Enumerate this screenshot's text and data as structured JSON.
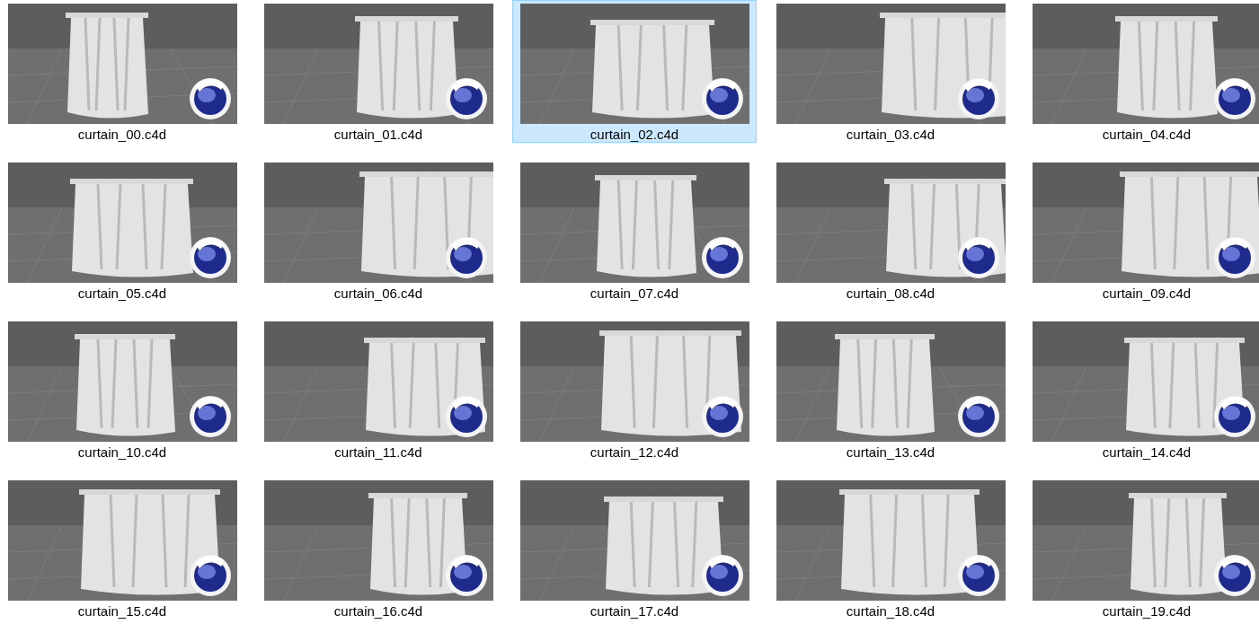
{
  "files": [
    {
      "name": "curtain_00.c4d",
      "selected": false
    },
    {
      "name": "curtain_01.c4d",
      "selected": false
    },
    {
      "name": "curtain_02.c4d",
      "selected": true
    },
    {
      "name": "curtain_03.c4d",
      "selected": false
    },
    {
      "name": "curtain_04.c4d",
      "selected": false
    },
    {
      "name": "curtain_05.c4d",
      "selected": false
    },
    {
      "name": "curtain_06.c4d",
      "selected": false
    },
    {
      "name": "curtain_07.c4d",
      "selected": false
    },
    {
      "name": "curtain_08.c4d",
      "selected": false
    },
    {
      "name": "curtain_09.c4d",
      "selected": false
    },
    {
      "name": "curtain_10.c4d",
      "selected": false
    },
    {
      "name": "curtain_11.c4d",
      "selected": false
    },
    {
      "name": "curtain_12.c4d",
      "selected": false
    },
    {
      "name": "curtain_13.c4d",
      "selected": false
    },
    {
      "name": "curtain_14.c4d",
      "selected": false
    },
    {
      "name": "curtain_15.c4d",
      "selected": false
    },
    {
      "name": "curtain_16.c4d",
      "selected": false
    },
    {
      "name": "curtain_17.c4d",
      "selected": false
    },
    {
      "name": "curtain_18.c4d",
      "selected": false
    },
    {
      "name": "curtain_19.c4d",
      "selected": false
    }
  ]
}
